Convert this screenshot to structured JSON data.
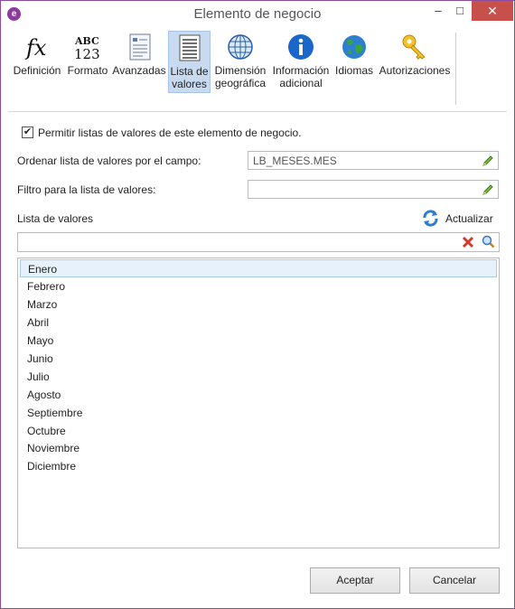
{
  "window": {
    "title": "Elemento de negocio",
    "minimize_glyph": "–",
    "maximize_glyph": "□",
    "close_glyph": "✕",
    "app_icon_letter": "e",
    "accent": "#8e3b9e"
  },
  "toolbar": {
    "items": [
      {
        "line1": "Definición",
        "line2": "",
        "icon": "fx-icon"
      },
      {
        "line1": "Formato",
        "line2": "",
        "icon": "abc-123-icon"
      },
      {
        "line1": "Avanzadas",
        "line2": "",
        "icon": "document-list-icon"
      },
      {
        "line1": "Lista de",
        "line2": "valores",
        "icon": "list-document-icon",
        "active": true
      },
      {
        "line1": "Dimensión",
        "line2": "geográfica",
        "icon": "globe-grid-icon"
      },
      {
        "line1": "Información",
        "line2": "adicional",
        "icon": "info-icon"
      },
      {
        "line1": "Idiomas",
        "line2": "",
        "icon": "earth-icon"
      },
      {
        "line1": "Autorizaciones",
        "line2": "",
        "icon": "key-icon"
      }
    ]
  },
  "form": {
    "enable_lov_label": "Permitir listas de valores de este elemento de negocio.",
    "enable_lov_checked": true,
    "sort_label": "Ordenar lista de valores por el campo:",
    "sort_value": "LB_MESES.MES",
    "filter_label": "Filtro para la lista de valores:",
    "filter_value": "",
    "list_label": "Lista de valores",
    "refresh_label": "Actualizar",
    "search_value": ""
  },
  "values": [
    "Enero",
    "Febrero",
    "Marzo",
    "Abril",
    "Mayo",
    "Junio",
    "Julio",
    "Agosto",
    "Septiembre",
    "Octubre",
    "Noviembre",
    "Diciembre"
  ],
  "selected_value": "Enero",
  "buttons": {
    "ok_label": "Aceptar",
    "cancel_label": "Cancelar"
  }
}
